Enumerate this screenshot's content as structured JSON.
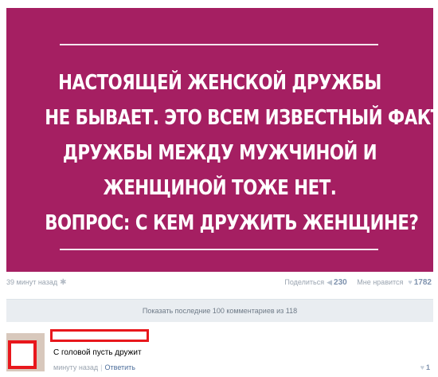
{
  "post": {
    "image_text": [
      "НАСТОЯЩЕЙ ЖЕНСКОЙ ДРУЖБЫ",
      "НЕ БЫВАЕТ. ЭТО ВСЕМ ИЗВЕСТНЫЙ ФАКТ.",
      "ДРУЖБЫ МЕЖДУ МУЖЧИНОЙ И",
      "ЖЕНЩИНОЙ ТОЖЕ НЕТ.",
      "ВОПРОС: С КЕМ ДРУЖИТЬ ЖЕНЩИНЕ?"
    ],
    "time": "39 минут назад",
    "share_label": "Поделиться",
    "share_count": "230",
    "like_label": "Мне нравится",
    "like_count": "1782"
  },
  "comments": {
    "show_more_label": "Показать последние 100 комментариев из 118",
    "items": [
      {
        "text": "С головой пусть дружит",
        "time": "минуту назад",
        "reply_label": "Ответить",
        "likes": "1"
      }
    ]
  },
  "colors": {
    "poster_bg": "#a51f62",
    "redaction": "#e8171c",
    "link": "#4e6f9c"
  },
  "icons": [
    "gear-icon",
    "megaphone-icon",
    "heart-icon"
  ]
}
